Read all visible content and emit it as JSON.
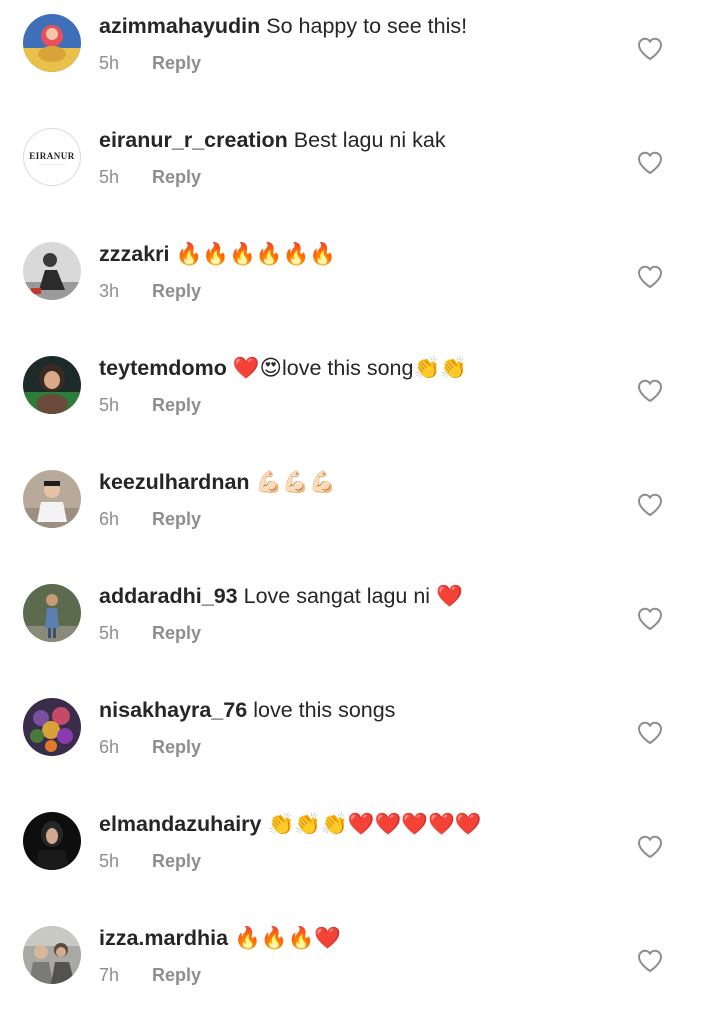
{
  "comments": [
    {
      "username": "azimmahayudin",
      "text": "So happy to see this!",
      "time": "5h",
      "reply": "Reply",
      "avatar": "yellow-orange-portrait"
    },
    {
      "username": "eiranur_r_creation",
      "text": "Best lagu ni kak",
      "time": "5h",
      "reply": "Reply",
      "avatar": "eiranur-logo",
      "avatar_text": "EIRANUR"
    },
    {
      "username": "zzzakri",
      "text": "🔥🔥🔥🔥🔥🔥",
      "time": "3h",
      "reply": "Reply",
      "avatar": "person-gray-portrait"
    },
    {
      "username": "teytemdomo",
      "text": "❤️😍love this song👏👏",
      "time": "5h",
      "reply": "Reply",
      "avatar": "woman-dark-portrait"
    },
    {
      "username": "keezulhardnan",
      "text": "💪🏻💪🏻💪🏻",
      "time": "6h",
      "reply": "Reply",
      "avatar": "man-white-shirt-portrait"
    },
    {
      "username": "addaradhi_93",
      "text": "Love sangat lagu ni ❤️",
      "time": "5h",
      "reply": "Reply",
      "avatar": "person-outdoor-portrait"
    },
    {
      "username": "nisakhayra_76",
      "text": "love this songs",
      "time": "6h",
      "reply": "Reply",
      "avatar": "flower-bouquet"
    },
    {
      "username": "elmandazuhairy",
      "text": "👏👏👏❤️❤️❤️❤️❤️",
      "time": "5h",
      "reply": "Reply",
      "avatar": "woman-black-portrait"
    },
    {
      "username": "izza.mardhia",
      "text": "🔥🔥🔥❤️",
      "time": "7h",
      "reply": "Reply",
      "avatar": "group-gray-portrait"
    }
  ],
  "like_icon": "heart-outline-icon",
  "colors": {
    "text": "#262626",
    "secondary": "#8e8e8e",
    "background": "#ffffff"
  }
}
